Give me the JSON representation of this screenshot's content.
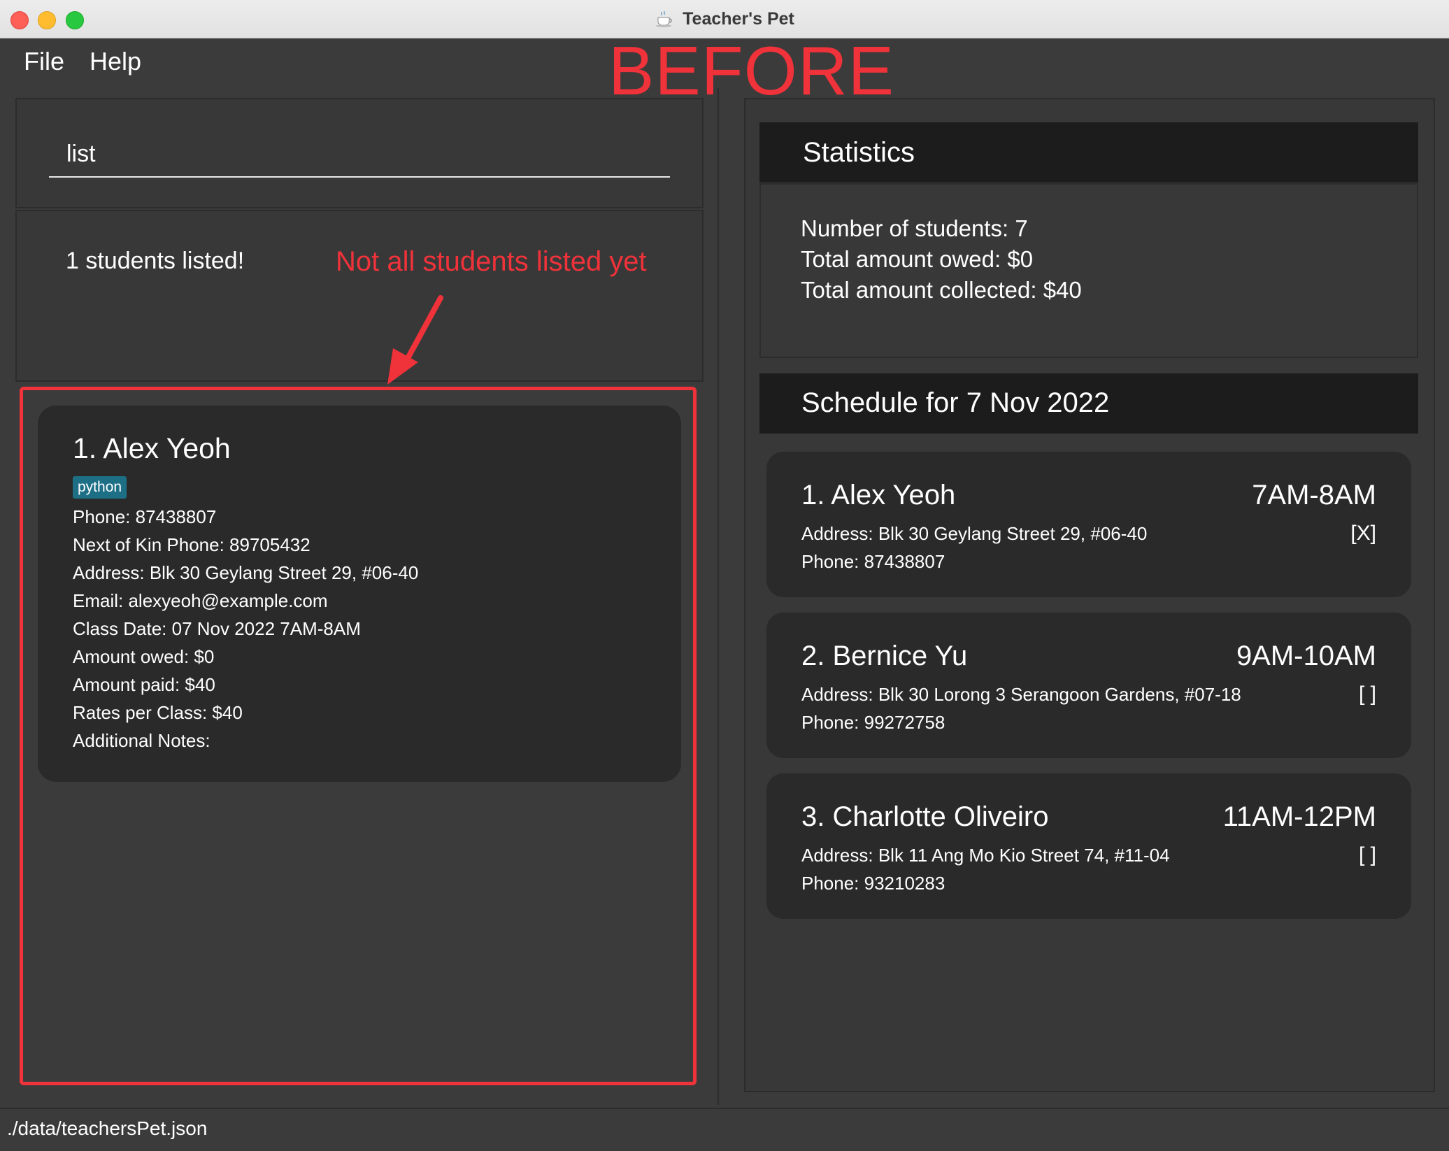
{
  "window": {
    "title": "Teacher's Pet"
  },
  "menu": {
    "items": [
      "File",
      "Help"
    ]
  },
  "annotations": {
    "before": "BEFORE",
    "note": "Not all students listed yet",
    "accent_color": "#f0323a"
  },
  "command": {
    "value": "list"
  },
  "result": {
    "message": "1 students listed!"
  },
  "student_list": [
    {
      "name": "1.  Alex Yeoh",
      "tag": "python",
      "phone": "Phone: 87438807",
      "nok_phone": "Next of Kin Phone:  89705432",
      "address": "Address:  Blk 30 Geylang Street 29, #06-40",
      "email": "Email:  alexyeoh@example.com",
      "class_date": "Class Date: 07 Nov 2022 7AM-8AM",
      "amount_owed": "Amount owed: $0",
      "amount_paid": "Amount paid: $40",
      "rates": "Rates per Class: $40",
      "notes": "Additional Notes:"
    }
  ],
  "statistics": {
    "title": "Statistics",
    "lines": [
      "Number of students: 7",
      "Total amount owed: $0",
      "Total amount collected: $40"
    ]
  },
  "schedule": {
    "title": "Schedule for 7 Nov 2022",
    "items": [
      {
        "name": "1.  Alex Yeoh",
        "time": "7AM-8AM",
        "address": "Address:  Blk 30 Geylang Street 29, #06-40",
        "marker": "[X]",
        "phone": "Phone: 87438807"
      },
      {
        "name": "2.  Bernice Yu",
        "time": "9AM-10AM",
        "address": "Address:  Blk 30 Lorong 3 Serangoon Gardens, #07-18",
        "marker": "[ ]",
        "phone": "Phone: 99272758"
      },
      {
        "name": "3.  Charlotte Oliveiro",
        "time": "11AM-12PM",
        "address": "Address:  Blk 11 Ang Mo Kio Street 74, #11-04",
        "marker": "[ ]",
        "phone": "Phone: 93210283"
      }
    ]
  },
  "status": {
    "path": "./data/teachersPet.json"
  },
  "colors": {
    "background": "#3b3b3b",
    "card": "#2a2a2a",
    "header": "#1c1c1c",
    "tag": "#1d6f86"
  }
}
